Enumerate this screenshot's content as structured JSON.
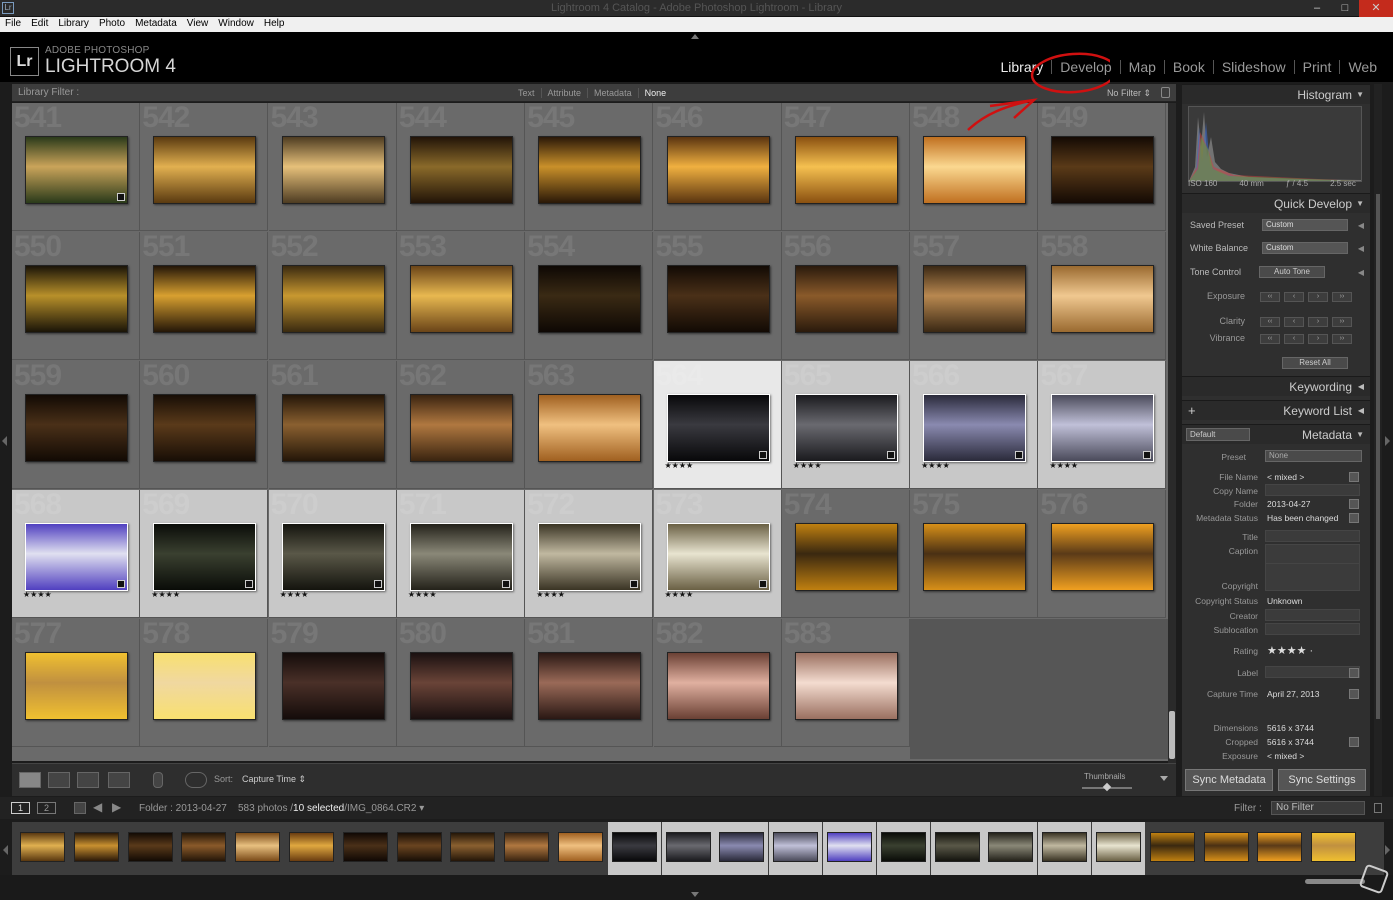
{
  "window": {
    "title": "Lightroom 4 Catalog - Adobe Photoshop Lightroom - Library"
  },
  "menu": [
    "File",
    "Edit",
    "Library",
    "Photo",
    "Metadata",
    "View",
    "Window",
    "Help"
  ],
  "brand": {
    "top": "ADOBE PHOTOSHOP",
    "name": "LIGHTROOM 4",
    "logo": "Lr"
  },
  "modules": [
    {
      "label": "Library",
      "active": true
    },
    {
      "label": "Develop",
      "active": false
    },
    {
      "label": "Map",
      "active": false
    },
    {
      "label": "Book",
      "active": false
    },
    {
      "label": "Slideshow",
      "active": false
    },
    {
      "label": "Print",
      "active": false
    },
    {
      "label": "Web",
      "active": false
    }
  ],
  "filterbar": {
    "label": "Library Filter :",
    "options": [
      "Text",
      "Attribute",
      "Metadata",
      "None"
    ],
    "selected": "None",
    "preset": "No Filter"
  },
  "grid": {
    "cells": [
      {
        "n": "541",
        "c1": "#caa45a",
        "c2": "#2a3a1a",
        "sel": false,
        "stars": ""
      },
      {
        "n": "542",
        "c1": "#e2b050",
        "c2": "#5a3a10",
        "sel": false,
        "stars": ""
      },
      {
        "n": "543",
        "c1": "#e6c07a",
        "c2": "#4e3c22",
        "sel": false,
        "stars": ""
      },
      {
        "n": "544",
        "c1": "#8a6a2a",
        "c2": "#221408",
        "sel": false,
        "stars": ""
      },
      {
        "n": "545",
        "c1": "#c9902a",
        "c2": "#2a1808",
        "sel": false,
        "stars": ""
      },
      {
        "n": "546",
        "c1": "#f0b040",
        "c2": "#5a3410",
        "sel": false,
        "stars": ""
      },
      {
        "n": "547",
        "c1": "#f5c050",
        "c2": "#8a5010",
        "sel": false,
        "stars": ""
      },
      {
        "n": "548",
        "c1": "#fbd890",
        "c2": "#c07020",
        "sel": false,
        "stars": ""
      },
      {
        "n": "549",
        "c1": "#5a3a18",
        "c2": "#140a04",
        "sel": false,
        "stars": ""
      },
      {
        "n": "550",
        "c1": "#b8902a",
        "c2": "#1a1408",
        "sel": false,
        "stars": ""
      },
      {
        "n": "551",
        "c1": "#d8a030",
        "c2": "#241608",
        "sel": false,
        "stars": ""
      },
      {
        "n": "552",
        "c1": "#c89830",
        "c2": "#3a2a10",
        "sel": false,
        "stars": ""
      },
      {
        "n": "553",
        "c1": "#e8b850",
        "c2": "#6a4418",
        "sel": false,
        "stars": ""
      },
      {
        "n": "554",
        "c1": "#3a2a14",
        "c2": "#0e0804",
        "sel": false,
        "stars": ""
      },
      {
        "n": "555",
        "c1": "#4a3018",
        "c2": "#120a04",
        "sel": false,
        "stars": ""
      },
      {
        "n": "556",
        "c1": "#8a5a2a",
        "c2": "#2a1a0c",
        "sel": false,
        "stars": ""
      },
      {
        "n": "557",
        "c1": "#b88850",
        "c2": "#3a2814",
        "sel": false,
        "stars": ""
      },
      {
        "n": "558",
        "c1": "#f0c890",
        "c2": "#9a6a30",
        "sel": false,
        "stars": ""
      },
      {
        "n": "559",
        "c1": "#4a3018",
        "c2": "#120a04",
        "sel": false,
        "stars": ""
      },
      {
        "n": "560",
        "c1": "#5a3a1a",
        "c2": "#180e06",
        "sel": false,
        "stars": ""
      },
      {
        "n": "561",
        "c1": "#8a6030",
        "c2": "#241608",
        "sel": false,
        "stars": ""
      },
      {
        "n": "562",
        "c1": "#b07840",
        "c2": "#3a2410",
        "sel": false,
        "stars": ""
      },
      {
        "n": "563",
        "c1": "#f0c080",
        "c2": "#a06020",
        "sel": false,
        "stars": ""
      },
      {
        "n": "564",
        "c1": "#3a3a40",
        "c2": "#08080a",
        "sel": true,
        "stars": "★★★★"
      },
      {
        "n": "565",
        "c1": "#6a6a70",
        "c2": "#1a1a1e",
        "sel": true,
        "stars": "★★★★"
      },
      {
        "n": "566",
        "c1": "#8a8ab0",
        "c2": "#2a2a3a",
        "sel": true,
        "stars": "★★★★"
      },
      {
        "n": "567",
        "c1": "#c0c0d8",
        "c2": "#4a4a5a",
        "sel": true,
        "stars": "★★★★"
      },
      {
        "n": "568",
        "c1": "#e0e0f0",
        "c2": "#5040c0",
        "sel": true,
        "stars": "★★★★"
      },
      {
        "n": "569",
        "c1": "#3a4030",
        "c2": "#0a0c08",
        "sel": true,
        "stars": "★★★★"
      },
      {
        "n": "570",
        "c1": "#5a5848",
        "c2": "#14140e",
        "sel": true,
        "stars": "★★★★"
      },
      {
        "n": "571",
        "c1": "#8a8878",
        "c2": "#24221a",
        "sel": true,
        "stars": "★★★★"
      },
      {
        "n": "572",
        "c1": "#c0b8a0",
        "c2": "#3a3424",
        "sel": true,
        "stars": "★★★★"
      },
      {
        "n": "573",
        "c1": "#e8e4d0",
        "c2": "#6a6044",
        "sel": true,
        "stars": "★★★★"
      },
      {
        "n": "574",
        "c1": "#3a2810",
        "c2": "#c08010",
        "sel": false,
        "stars": ""
      },
      {
        "n": "575",
        "c1": "#4a3014",
        "c2": "#d89018",
        "sel": false,
        "stars": ""
      },
      {
        "n": "576",
        "c1": "#5a3a18",
        "c2": "#f0a020",
        "sel": false,
        "stars": ""
      },
      {
        "n": "577",
        "c1": "#c09040",
        "c2": "#f0c030",
        "sel": false,
        "stars": ""
      },
      {
        "n": "578",
        "c1": "#f0d8a0",
        "c2": "#f8e070",
        "sel": false,
        "stars": ""
      },
      {
        "n": "579",
        "c1": "#4a3028",
        "c2": "#140c0a",
        "sel": false,
        "stars": ""
      },
      {
        "n": "580",
        "c1": "#6a4438",
        "c2": "#1a1010",
        "sel": false,
        "stars": ""
      },
      {
        "n": "581",
        "c1": "#9a6a58",
        "c2": "#2a1814",
        "sel": false,
        "stars": ""
      },
      {
        "n": "582",
        "c1": "#e0b0a0",
        "c2": "#6a4034",
        "sel": false,
        "stars": ""
      },
      {
        "n": "583",
        "c1": "#f4dcd0",
        "c2": "#9a7060",
        "sel": false,
        "stars": ""
      }
    ]
  },
  "toolbar": {
    "sort_label": "Sort:",
    "sort_value": "Capture Time",
    "thumbs_label": "Thumbnails"
  },
  "right_panel": {
    "histogram": {
      "title": "Histogram",
      "info": [
        "ISO 160",
        "40 mm",
        "ƒ / 4.5",
        "2.5 sec"
      ]
    },
    "quick_develop": {
      "title": "Quick Develop",
      "saved_preset_label": "Saved Preset",
      "saved_preset_value": "Custom",
      "white_balance_label": "White Balance",
      "white_balance_value": "Custom",
      "tone_control_label": "Tone Control",
      "auto_tone": "Auto Tone",
      "exposure_label": "Exposure",
      "clarity_label": "Clarity",
      "vibrance_label": "Vibrance",
      "reset_all": "Reset All"
    },
    "keywording": "Keywording",
    "keyword_list": "Keyword List",
    "metadata": {
      "title": "Metadata",
      "set_value": "Default",
      "preset_label": "Preset",
      "preset_value": "None",
      "rows": [
        {
          "label": "File Name",
          "value": "< mixed >"
        },
        {
          "label": "Copy Name",
          "value": ""
        },
        {
          "label": "Folder",
          "value": "2013-04-27"
        },
        {
          "label": "Metadata Status",
          "value": "Has been changed"
        },
        {
          "label": "Title",
          "value": ""
        },
        {
          "label": "Caption",
          "value": ""
        },
        {
          "label": "Copyright",
          "value": ""
        },
        {
          "label": "Copyright Status",
          "value": "Unknown"
        },
        {
          "label": "Creator",
          "value": ""
        },
        {
          "label": "Sublocation",
          "value": ""
        },
        {
          "label": "Rating",
          "value": "★★★★ ·"
        },
        {
          "label": "Label",
          "value": ""
        },
        {
          "label": "Capture Time",
          "value": "April 27, 2013"
        },
        {
          "label": "Dimensions",
          "value": "5616 x 3744"
        },
        {
          "label": "Cropped",
          "value": "5616 x 3744"
        },
        {
          "label": "Exposure",
          "value": "< mixed >"
        }
      ]
    },
    "sync_metadata": "Sync Metadata",
    "sync_settings": "Sync Settings"
  },
  "filmbar": {
    "screen1": "1",
    "screen2": "2",
    "folder": "Folder : 2013-04-27",
    "count": "583 photos /",
    "selected": "10 selected",
    "file": "/IMG_0864.CR2",
    "filter_label": "Filter :",
    "filter_value": "No Filter"
  },
  "filmstrip": [
    {
      "c1": "#e0b050",
      "c2": "#5a3810",
      "sel": false
    },
    {
      "c1": "#c89030",
      "c2": "#2a1808",
      "sel": false
    },
    {
      "c1": "#5a3a1a",
      "c2": "#120a04",
      "sel": false
    },
    {
      "c1": "#8a5a2a",
      "c2": "#241608",
      "sel": false
    },
    {
      "c1": "#e8c080",
      "c2": "#7a4a18",
      "sel": false
    },
    {
      "c1": "#e0a840",
      "c2": "#6a3c10",
      "sel": false
    },
    {
      "c1": "#4a3018",
      "c2": "#100804",
      "sel": false
    },
    {
      "c1": "#6a4420",
      "c2": "#180e06",
      "sel": false
    },
    {
      "c1": "#8a6030",
      "c2": "#241608",
      "sel": false
    },
    {
      "c1": "#b07840",
      "c2": "#3a2410",
      "sel": false
    },
    {
      "c1": "#f0c080",
      "c2": "#a06020",
      "sel": false
    },
    {
      "c1": "#3a3a40",
      "c2": "#08080a",
      "sel": true
    },
    {
      "c1": "#6a6a70",
      "c2": "#1a1a1e",
      "sel": true
    },
    {
      "c1": "#8a8ab0",
      "c2": "#2a2a3a",
      "sel": true
    },
    {
      "c1": "#c0c0d8",
      "c2": "#4a4a5a",
      "sel": true
    },
    {
      "c1": "#e0e0f0",
      "c2": "#5040c0",
      "sel": true
    },
    {
      "c1": "#3a4030",
      "c2": "#0a0c08",
      "sel": true
    },
    {
      "c1": "#5a5848",
      "c2": "#14140e",
      "sel": true
    },
    {
      "c1": "#8a8878",
      "c2": "#24221a",
      "sel": true
    },
    {
      "c1": "#c0b8a0",
      "c2": "#3a3424",
      "sel": true
    },
    {
      "c1": "#e8e4d0",
      "c2": "#6a6044",
      "sel": true
    },
    {
      "c1": "#3a2810",
      "c2": "#c08010",
      "sel": false
    },
    {
      "c1": "#4a3014",
      "c2": "#d89018",
      "sel": false
    },
    {
      "c1": "#5a3a18",
      "c2": "#f0a020",
      "sel": false
    },
    {
      "c1": "#c09040",
      "c2": "#f0c030",
      "sel": false
    }
  ],
  "colors": {
    "accent": "#e0e0e0",
    "selected_cell": "#c8c8c8",
    "selected_cell_primary": "#e8e8e8",
    "annotation": "#d01010"
  }
}
